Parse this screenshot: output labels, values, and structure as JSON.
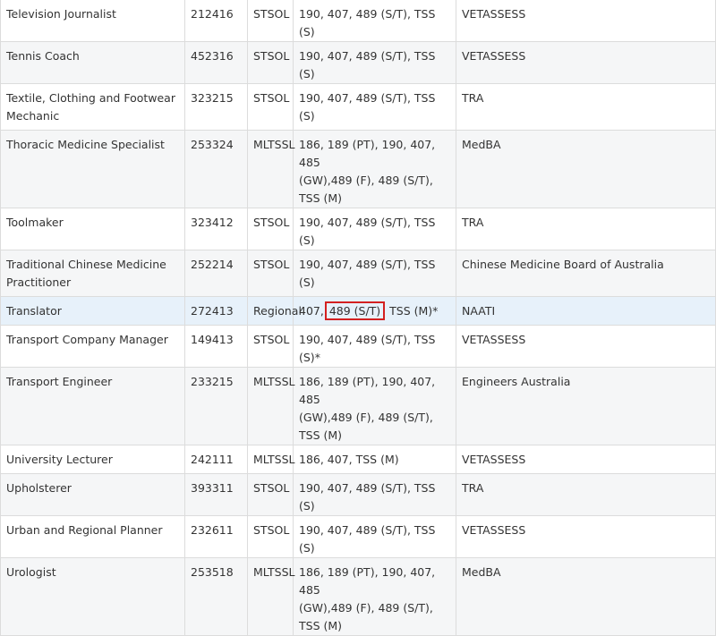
{
  "rows": [
    {
      "occupation": "Television Journalist",
      "code": "212416",
      "list": "STSOL",
      "visas": "190, 407, 489 (S/T), TSS (S)",
      "authority": "VETASSESS"
    },
    {
      "occupation": "Tennis Coach",
      "code": "452316",
      "list": "STSOL",
      "visas": "190, 407, 489 (S/T), TSS (S)",
      "authority": "VETASSESS"
    },
    {
      "occupation": "Textile, Clothing and Footwear\nMechanic",
      "code": "323215",
      "list": "STSOL",
      "visas": "190, 407, 489 (S/T), TSS (S)",
      "authority": "TRA"
    },
    {
      "occupation": "Thoracic Medicine Specialist",
      "code": "253324",
      "list": "MLTSSL",
      "visas": "186, 189 (PT), 190, 407, 485\n(GW),489 (F), 489 (S/T), TSS (M)",
      "authority": "MedBA"
    },
    {
      "occupation": "Toolmaker",
      "code": "323412",
      "list": "STSOL",
      "visas": "190, 407, 489 (S/T), TSS (S)",
      "authority": "TRA"
    },
    {
      "occupation": "Traditional Chinese Medicine\nPractitioner",
      "code": "252214",
      "list": "STSOL",
      "visas": "190, 407, 489 (S/T), TSS (S)",
      "authority": "Chinese Medicine Board of Australia"
    },
    {
      "occupation": "Translator",
      "code": "272413",
      "list": "Regional",
      "visas_pre": "407, ",
      "visas_mark": "489 (S/T)",
      "visas_post": ", TSS (M)*",
      "authority": "NAATI"
    },
    {
      "occupation": "Transport Company Manager",
      "code": "149413",
      "list": "STSOL",
      "visas": "190, 407, 489 (S/T), TSS (S)*",
      "authority": "VETASSESS"
    },
    {
      "occupation": "Transport Engineer",
      "code": "233215",
      "list": "MLTSSL",
      "visas": "186, 189 (PT), 190, 407, 485\n(GW),489 (F), 489 (S/T), TSS (M)",
      "authority": "Engineers Australia"
    },
    {
      "occupation": "University Lecturer",
      "code": "242111",
      "list": "MLTSSL",
      "visas": "186, 407, TSS (M)",
      "authority": "VETASSESS"
    },
    {
      "occupation": "Upholsterer",
      "code": "393311",
      "list": "STSOL",
      "visas": "190, 407, 489 (S/T), TSS (S)",
      "authority": "TRA"
    },
    {
      "occupation": "Urban and Regional Planner",
      "code": "232611",
      "list": "STSOL",
      "visas": "190, 407, 489 (S/T), TSS (S)",
      "authority": "VETASSESS"
    },
    {
      "occupation": "Urologist",
      "code": "253518",
      "list": "MLTSSL",
      "visas": "186, 189 (PT), 190, 407, 485\n(GW),489 (F), 489 (S/T), TSS (M)",
      "authority": "MedBA"
    }
  ]
}
